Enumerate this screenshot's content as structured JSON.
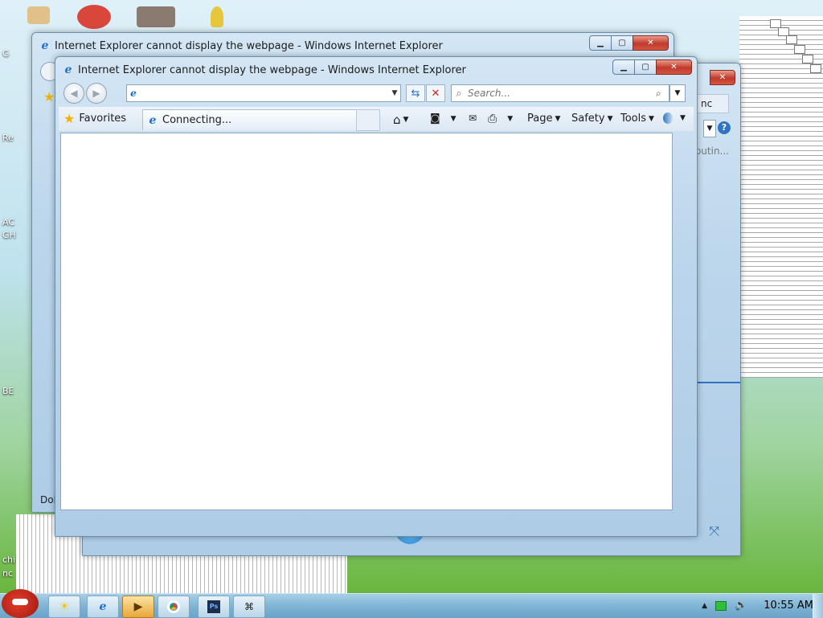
{
  "back_window": {
    "title": "Internet Explorer cannot display the webpage - Windows Internet Explorer",
    "status": "Dol"
  },
  "front_window": {
    "title": "Internet Explorer cannot display the webpage - Windows Internet Explorer",
    "address": {
      "value": "",
      "placeholder": ""
    },
    "search": {
      "placeholder": "Search..."
    },
    "favorites_label": "Favorites",
    "tab_label": "Connecting...",
    "menu": {
      "page": "Page",
      "safety": "Safety",
      "tools": "Tools"
    }
  },
  "behind_window": {
    "tab_fragment": "nc",
    "text_fragment": "butin..."
  },
  "desktop": {
    "labels": [
      "G",
      "Re",
      "AC",
      "GH",
      "BE",
      "chi",
      "nc"
    ]
  },
  "taskbar": {
    "clock": "10:55 AM"
  },
  "colors": {
    "accent": "#1f6fd0",
    "close_red": "#c0392b",
    "taskbar": "#7fb4d4"
  }
}
